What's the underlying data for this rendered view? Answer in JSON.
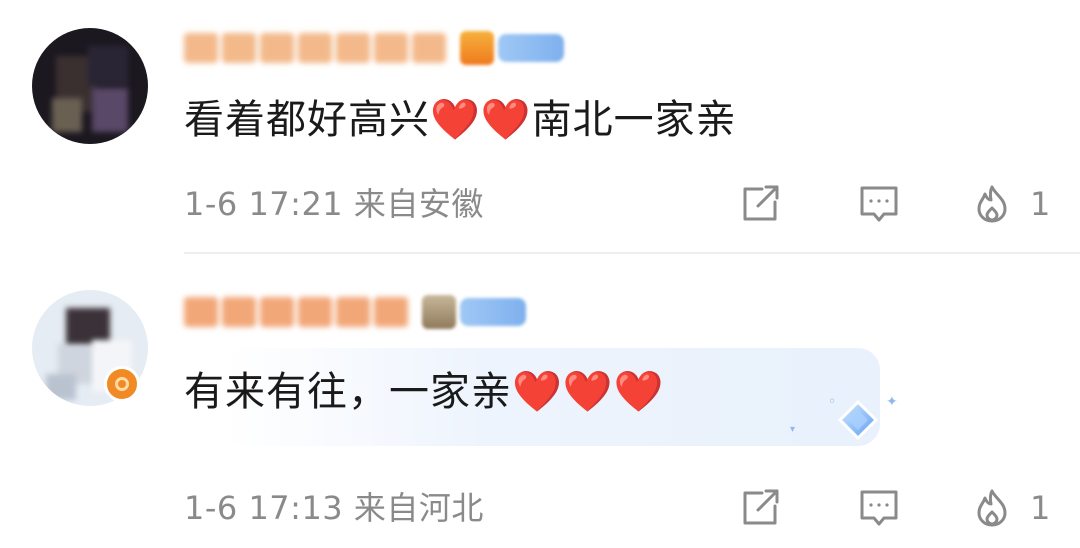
{
  "comments": [
    {
      "text": "看着都好高兴❤️❤️南北一家亲",
      "time": "1-6 17:21",
      "location": "来自安徽",
      "like_count": "1"
    },
    {
      "text": "有来有往，一家亲❤️❤️❤️",
      "time": "1-6 17:13",
      "location": "来自河北",
      "like_count": "1"
    }
  ],
  "icons": {
    "share": "share-icon",
    "reply": "reply-icon",
    "like": "fire-like-icon"
  },
  "colors": {
    "meta_text": "#8a8a8a",
    "username": "#f3b98a",
    "level_badge": "#9fc8f5",
    "vip_badge": "#f08a24"
  }
}
